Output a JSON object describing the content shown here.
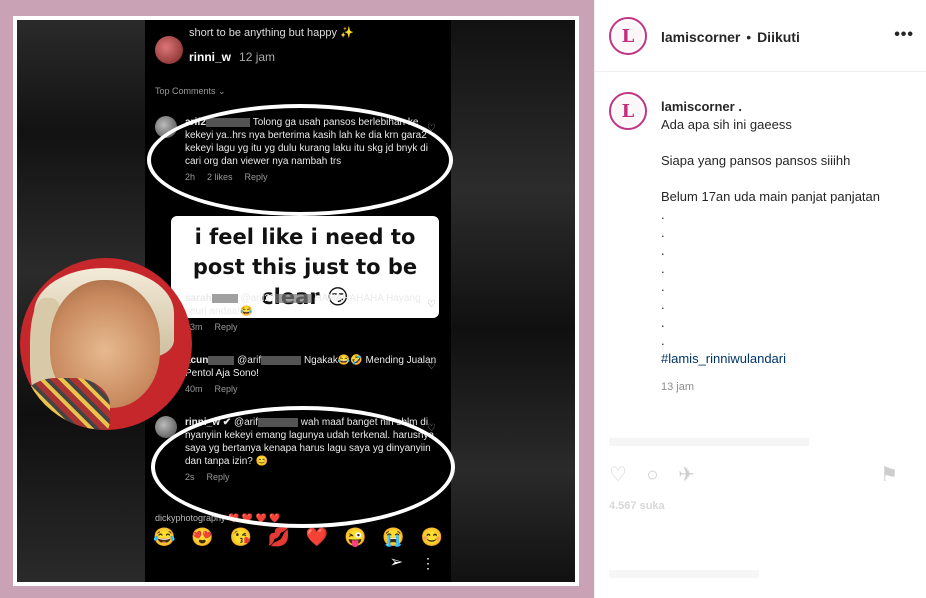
{
  "media": {
    "top": {
      "caption_line": "short to be anything but happy ✨",
      "user": "rinni_w",
      "time": "12 jam",
      "top_comments": "Top Comments ⌄"
    },
    "comments": [
      {
        "user": "arif2",
        "text": "Tolong ga usah pansos berlebihan ke kekeyi ya..hrs nya berterima kasih lah ke dia krn gara2 kekeyi lagu yg itu  yg dulu kurang laku itu skg jd bnyk di cari org dan viewer nya nambah trs",
        "time": "2h",
        "likes": "2 likes",
        "reply": "Reply"
      },
      {
        "user": "sarah",
        "mention": "@arif27",
        "text": "HAHAHAHAHA Hayang seuri andaa!😂",
        "time": "43m",
        "reply": "Reply"
      },
      {
        "user": "acun",
        "mention": "@arif",
        "text": "Ngakak😂🤣 Mending Jualan Pentol Aja Sono!",
        "time": "40m",
        "reply": "Reply"
      },
      {
        "user": "rinni_w ✔",
        "mention": "@arif",
        "text": "wah maaf banget nih sblm di nyanyiin kekeyi emang lagunya udah terkenal. harusnya saya yg bertanya kenapa harus lagu saya yg dinyanyiin dan tanpa izin? 😊",
        "time": "2s",
        "reply": "Reply"
      }
    ],
    "sticker": "i feel like i need to post this just to be clear 😏",
    "cut_comment": "dickyphotography ❤️ ❤️ ❤️ ❤️",
    "emojis": [
      "😂",
      "😍",
      "😘",
      "💋",
      "❤️",
      "😜",
      "😭",
      "😊"
    ],
    "send_icon": "➢",
    "more_icon": "⋮"
  },
  "header": {
    "logo_letter": "L",
    "username": "lamiscorner",
    "separator": "•",
    "follow_status": "Diikuti",
    "more": "•••"
  },
  "caption": {
    "username": "lamiscorner .",
    "lines": [
      "Ada apa sih ini gaeess",
      "",
      "Siapa yang pansos pansos siiihh",
      "",
      "Belum 17an uda main panjat panjatan",
      ".",
      ".",
      ".",
      ".",
      ".",
      ".",
      ".",
      "."
    ],
    "hashtag": "#lamis_rinniwulandari",
    "time": "13 jam"
  },
  "actions": {
    "like_icon": "♡",
    "comment_icon": "○",
    "share_icon": "✈",
    "save_icon": "⚑",
    "likes": "4.567 suka"
  }
}
